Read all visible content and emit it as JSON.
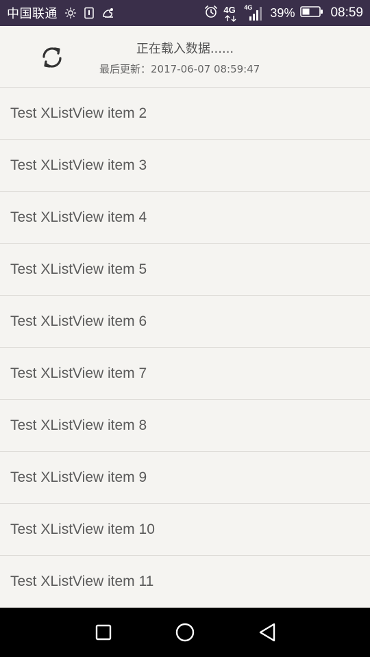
{
  "status_bar": {
    "carrier": "中国联通",
    "battery_percent": "39%",
    "time": "08:59",
    "network_label": "4G",
    "network_label_small": "4G",
    "icons": [
      "brightness-icon",
      "sim-icon",
      "notification-icon",
      "alarm-icon",
      "network-4g-icon",
      "signal-icon",
      "battery-icon"
    ],
    "background": "#3a2f4a"
  },
  "refresh_header": {
    "status_text": "正在载入数据......",
    "last_updated_label": "最后更新：",
    "last_updated_value": "2017-06-07 08:59:47",
    "icon": "refresh-icon"
  },
  "list": {
    "items": [
      {
        "label": "Test XListView item 2"
      },
      {
        "label": "Test XListView item 3"
      },
      {
        "label": "Test XListView item 4"
      },
      {
        "label": "Test XListView item 5"
      },
      {
        "label": "Test XListView item 6"
      },
      {
        "label": "Test XListView item 7"
      },
      {
        "label": "Test XListView item 8"
      },
      {
        "label": "Test XListView item 9"
      },
      {
        "label": "Test XListView item 10"
      },
      {
        "label": "Test XListView item 11"
      }
    ]
  },
  "nav_bar": {
    "buttons": [
      "recent-apps-icon",
      "home-icon",
      "back-icon"
    ]
  }
}
